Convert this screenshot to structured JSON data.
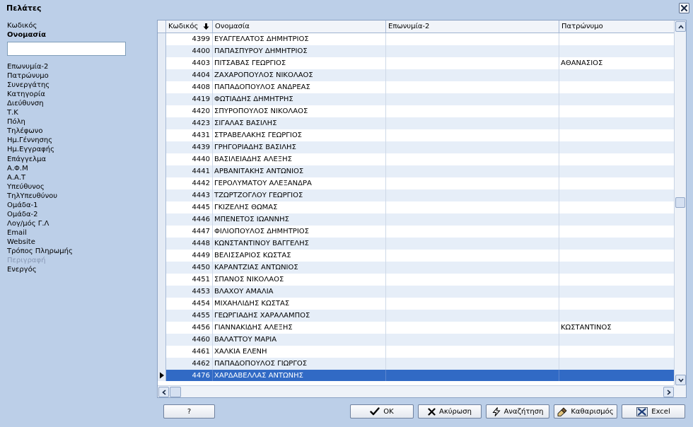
{
  "window": {
    "title": "Πελάτες"
  },
  "sort_fields": [
    {
      "label": "Κωδικός",
      "state": "normal"
    },
    {
      "label": "Ονομασία",
      "state": "active"
    }
  ],
  "search": {
    "value": "",
    "placeholder": ""
  },
  "filter_fields": [
    {
      "label": "Επωνυμία-2",
      "state": "normal"
    },
    {
      "label": "Πατρώνυμο",
      "state": "normal"
    },
    {
      "label": "Συνεργάτης",
      "state": "normal"
    },
    {
      "label": "Κατηγορία",
      "state": "normal"
    },
    {
      "label": "Διεύθυνση",
      "state": "normal"
    },
    {
      "label": "Τ.Κ",
      "state": "normal"
    },
    {
      "label": "Πόλη",
      "state": "normal"
    },
    {
      "label": "Τηλέφωνο",
      "state": "normal"
    },
    {
      "label": "Ημ.Γέννησης",
      "state": "normal"
    },
    {
      "label": "Ημ.Εγγραφής",
      "state": "normal"
    },
    {
      "label": "Επάγγελμα",
      "state": "normal"
    },
    {
      "label": "Α.Φ.Μ",
      "state": "normal"
    },
    {
      "label": "Α.Α.Τ",
      "state": "normal"
    },
    {
      "label": "Υπεύθυνος",
      "state": "normal"
    },
    {
      "label": "ΤηλΥπευθύνου",
      "state": "normal"
    },
    {
      "label": "Ομάδα-1",
      "state": "normal"
    },
    {
      "label": "Ομάδα-2",
      "state": "normal"
    },
    {
      "label": "Λογ/μός Γ.Λ",
      "state": "normal"
    },
    {
      "label": "Email",
      "state": "normal"
    },
    {
      "label": "Website",
      "state": "normal"
    },
    {
      "label": "Τρόπος Πληρωμής",
      "state": "normal"
    },
    {
      "label": "Περιγραφή",
      "state": "disabled"
    },
    {
      "label": "Ενεργός",
      "state": "normal"
    }
  ],
  "grid": {
    "columns": [
      {
        "label": "Κωδικός",
        "sorted": "descending",
        "sort_icon": "arrow-down-icon"
      },
      {
        "label": "Ονομασία"
      },
      {
        "label": "Επωνυμία-2"
      },
      {
        "label": "Πατρώνυμο"
      }
    ],
    "rows": [
      {
        "code": "4399",
        "name": "ΕΥΑΓΓΕΛΑΤΟΣ ΔΗΜΗΤΡΙΟΣ",
        "name2": "",
        "father": ""
      },
      {
        "code": "4400",
        "name": "ΠΑΠΑΣΠΥΡΟΥ ΔΗΜΗΤΡΙΟΣ",
        "name2": "",
        "father": ""
      },
      {
        "code": "4403",
        "name": "ΠΙΤΣΑΒΑΣ ΓΕΩΡΓΙΟΣ",
        "name2": "",
        "father": "ΑΘΑΝΑΣΙΟΣ"
      },
      {
        "code": "4404",
        "name": "ΖΑΧΑΡΟΠΟΥΛΟΣ ΝΙΚΟΛΑΟΣ",
        "name2": "",
        "father": ""
      },
      {
        "code": "4408",
        "name": "ΠΑΠΑΔΟΠΟΥΛΟΣ ΑΝΔΡΕΑΣ",
        "name2": "",
        "father": ""
      },
      {
        "code": "4419",
        "name": "ΦΩΤΙΑΔΗΣ ΔΗΜΗΤΡΗΣ",
        "name2": "",
        "father": ""
      },
      {
        "code": "4420",
        "name": "ΣΠΥΡΟΠΟΥΛΟΣ ΝΙΚΟΛΑΟΣ",
        "name2": "",
        "father": ""
      },
      {
        "code": "4423",
        "name": "ΣΙΓΑΛΑΣ ΒΑΣΙΛΗΣ",
        "name2": "",
        "father": ""
      },
      {
        "code": "4431",
        "name": "ΣΤΡΑΒΕΛΑΚΗΣ ΓΕΩΡΓΙΟΣ",
        "name2": "",
        "father": ""
      },
      {
        "code": "4439",
        "name": "ΓΡΗΓΟΡΙΑΔΗΣ ΒΑΣΙΛΗΣ",
        "name2": "",
        "father": ""
      },
      {
        "code": "4440",
        "name": "ΒΑΣΙΛΕΙΑΔΗΣ ΑΛΕΞΗΣ",
        "name2": "",
        "father": ""
      },
      {
        "code": "4441",
        "name": "ΑΡΒΑΝΙΤΑΚΗΣ ΑΝΤΩΝΙΟΣ",
        "name2": "",
        "father": ""
      },
      {
        "code": "4442",
        "name": "ΓΕΡΟΛΥΜΑΤΟΥ ΑΛΕΞΑΝΔΡΑ",
        "name2": "",
        "father": ""
      },
      {
        "code": "4443",
        "name": "ΤΖΩΡΤΖΟΓΛΟΥ ΓΕΩΡΓΙΟΣ",
        "name2": "",
        "father": ""
      },
      {
        "code": "4445",
        "name": "ΓΚΙΖΕΛΗΣ ΘΩΜΑΣ",
        "name2": "",
        "father": ""
      },
      {
        "code": "4446",
        "name": "ΜΠΕΝΕΤΟΣ ΙΩΑΝΝΗΣ",
        "name2": "",
        "father": ""
      },
      {
        "code": "4447",
        "name": "ΦΙΛΙΟΠΟΥΛΟΣ ΔΗΜΗΤΡΙΟΣ",
        "name2": "",
        "father": ""
      },
      {
        "code": "4448",
        "name": "ΚΩΝΣΤΑΝΤΙΝΟΥ ΒΑΓΓΕΛΗΣ",
        "name2": "",
        "father": ""
      },
      {
        "code": "4449",
        "name": "ΒΕΛΙΣΣΑΡΙΟΣ ΚΩΣΤΑΣ",
        "name2": "",
        "father": ""
      },
      {
        "code": "4450",
        "name": "ΚΑΡΑΝΤΖΙΑΣ ΑΝΤΩΝΙΟΣ",
        "name2": "",
        "father": ""
      },
      {
        "code": "4451",
        "name": "ΣΠΑΝΟΣ ΝΙΚΟΛΑΟΣ",
        "name2": "",
        "father": ""
      },
      {
        "code": "4453",
        "name": "ΒΛΑΧΟΥ ΑΜΑΛΙΑ",
        "name2": "",
        "father": ""
      },
      {
        "code": "4454",
        "name": "ΜΙΧΑΗΛΙΔΗΣ ΚΩΣΤΑΣ",
        "name2": "",
        "father": ""
      },
      {
        "code": "4455",
        "name": "ΓΕΩΡΓΙΑΔΗΣ ΧΑΡΑΛΑΜΠΟΣ",
        "name2": "",
        "father": ""
      },
      {
        "code": "4456",
        "name": "ΓΙΑΝΝΑΚΙΔΗΣ ΑΛΕΞΗΣ",
        "name2": "",
        "father": "ΚΩΣΤΑΝΤΙΝΟΣ"
      },
      {
        "code": "4460",
        "name": "ΒΑΛΑΤΤΟΥ ΜΑΡΙΑ",
        "name2": "",
        "father": ""
      },
      {
        "code": "4461",
        "name": "ΧΑΛΚΙΑ ΕΛΕΝΗ",
        "name2": "",
        "father": ""
      },
      {
        "code": "4462",
        "name": "ΠΑΠΑΔΟΠΟΥΛΟΣ ΓΙΩΡΓΟΣ",
        "name2": "",
        "father": ""
      },
      {
        "code": "4476",
        "name": "ΧΑΡΔΑΒΕΛΛΑΣ ΑΝΤΩΝΗΣ",
        "name2": "",
        "father": "",
        "selected": true
      }
    ]
  },
  "buttons": {
    "help": "?",
    "ok": "OK",
    "cancel": "Ακύρωση",
    "search": "Αναζήτηση",
    "clear": "Καθαρισμός",
    "excel": "Excel"
  },
  "colors": {
    "window_bg": "#bccfe8",
    "row_alt": "#e6eef8",
    "selection": "#316ac5"
  }
}
